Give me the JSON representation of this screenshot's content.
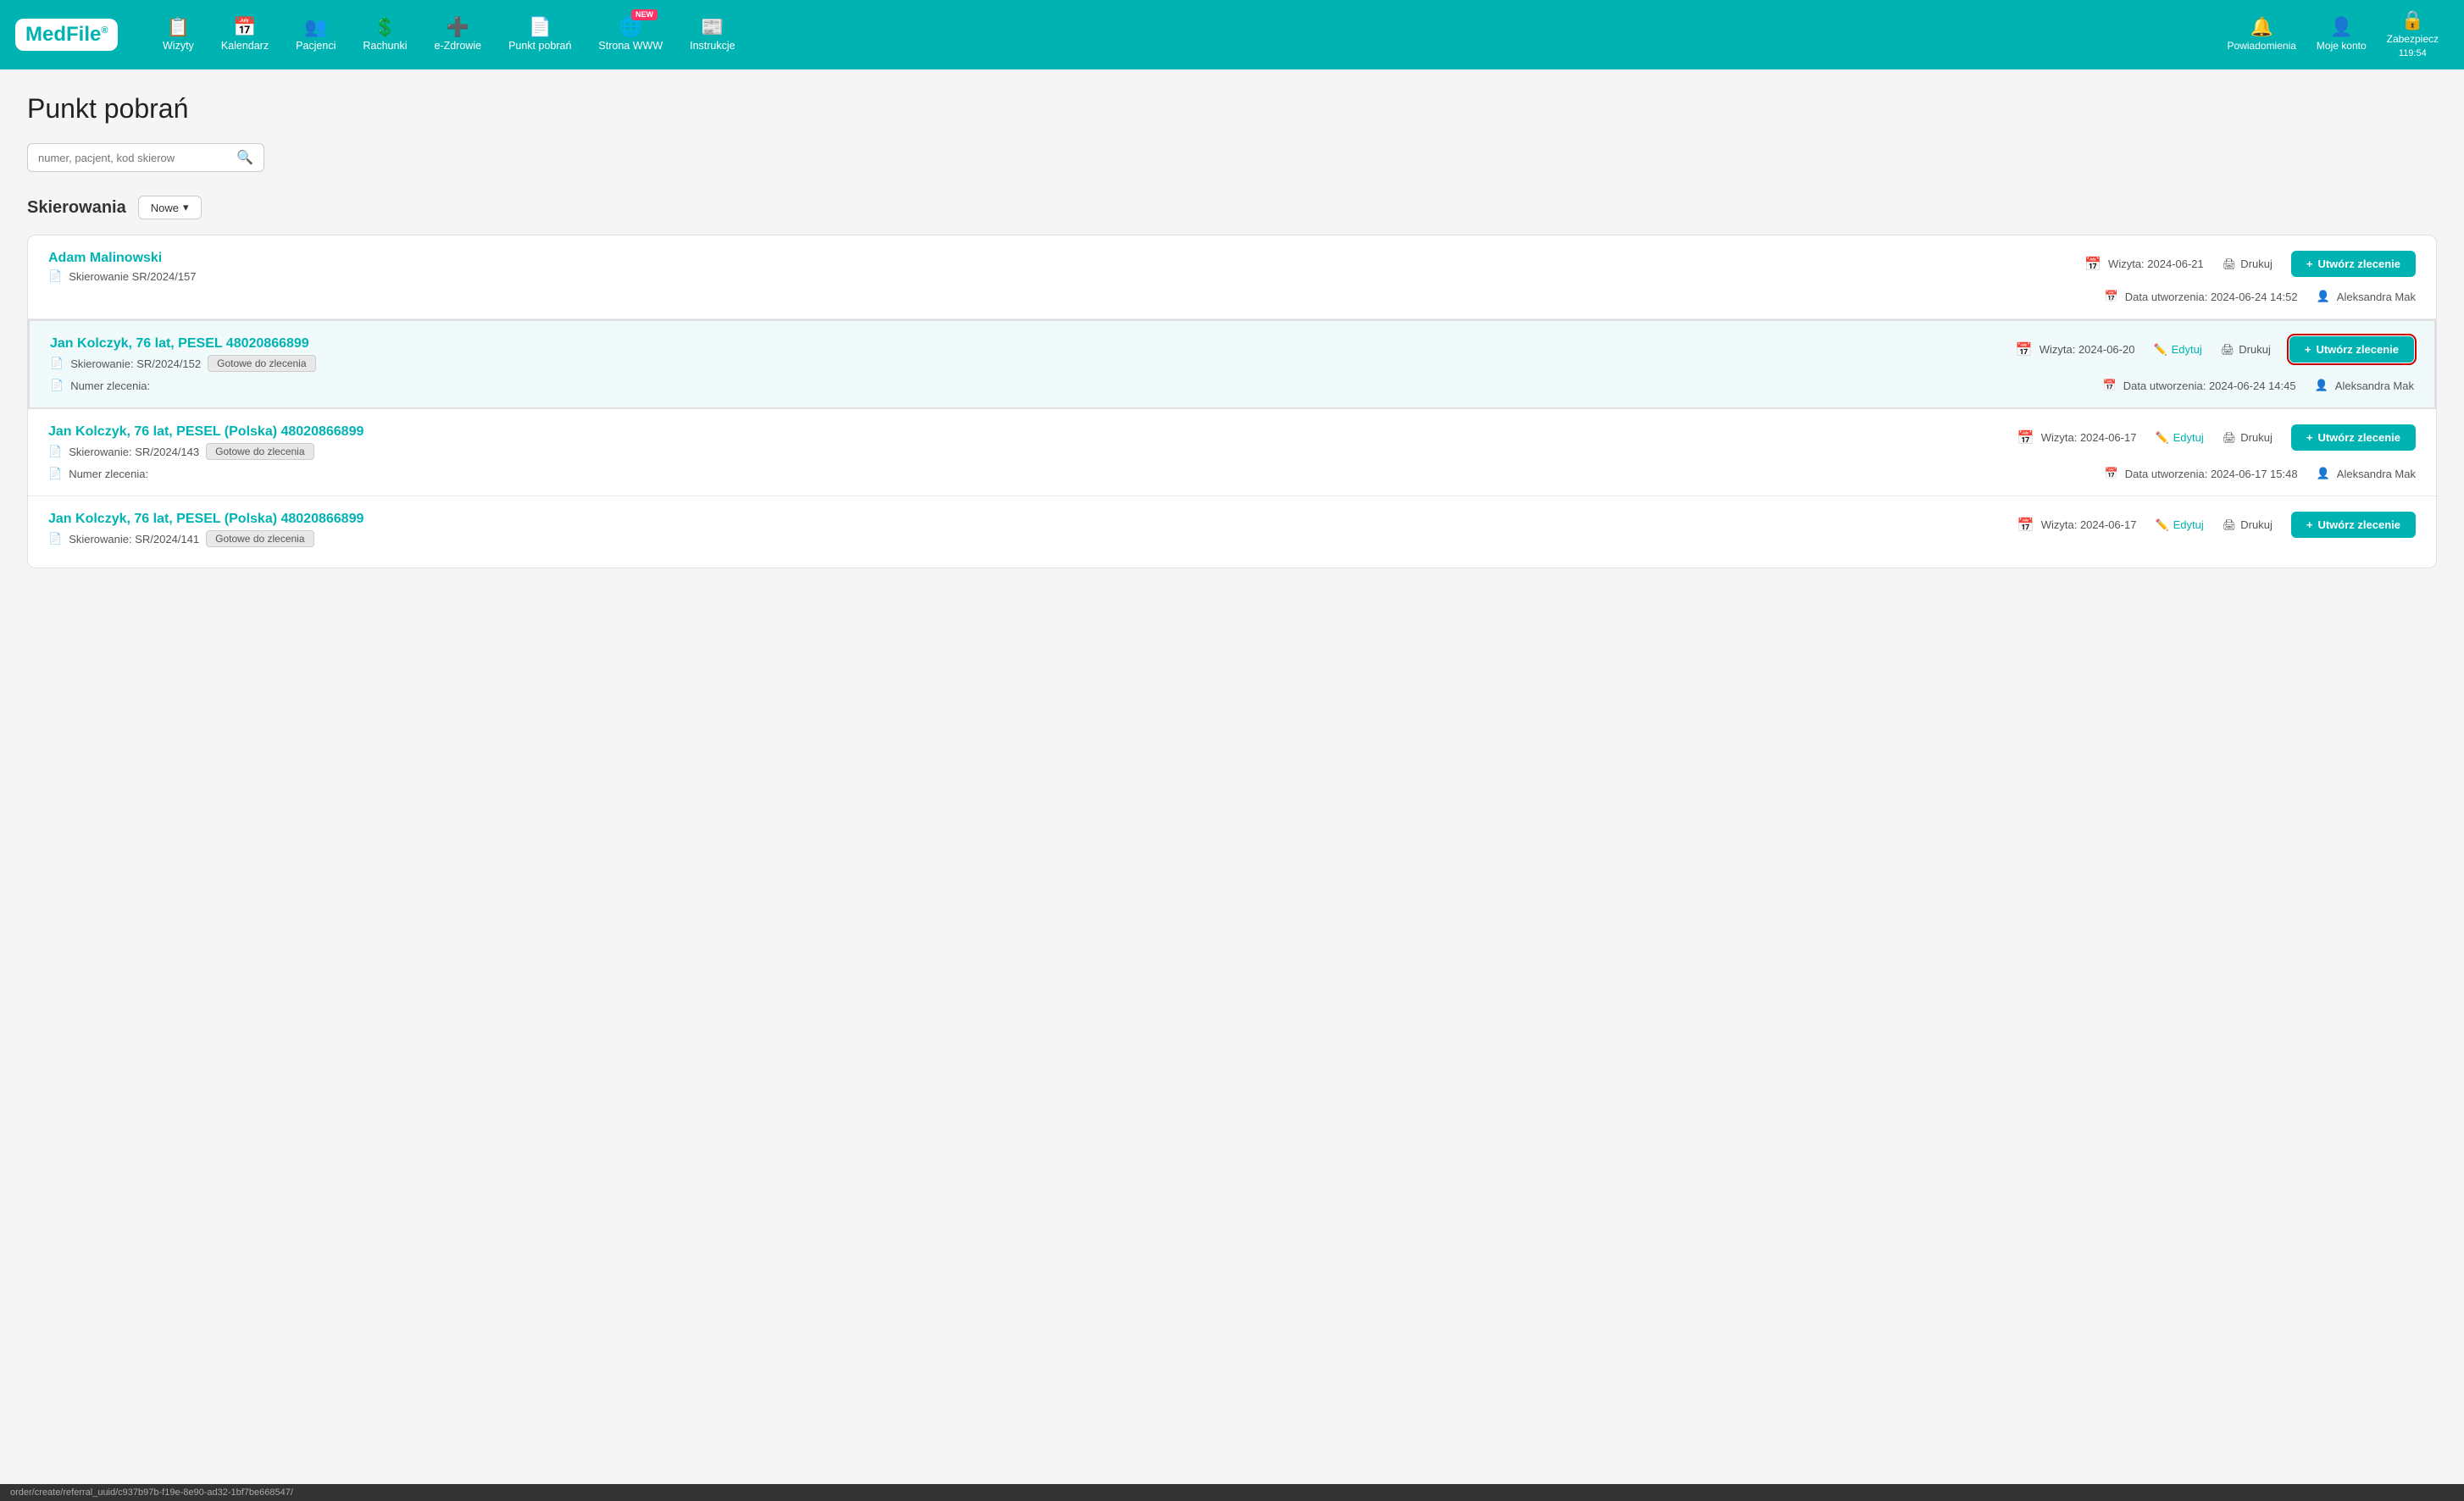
{
  "brand": {
    "med": "Med",
    "file": "File",
    "reg": "®"
  },
  "navbar": {
    "items": [
      {
        "id": "wizyty",
        "label": "Wizyty",
        "icon": "📋"
      },
      {
        "id": "kalendarz",
        "label": "Kalendarz",
        "icon": "📅"
      },
      {
        "id": "pacjenci",
        "label": "Pacjenci",
        "icon": "👥"
      },
      {
        "id": "rachunki",
        "label": "Rachunki",
        "icon": "💲"
      },
      {
        "id": "e-zdrowie",
        "label": "e-Zdrowie",
        "icon": "➕"
      },
      {
        "id": "punkt-pobran",
        "label": "Punkt pobrań",
        "icon": "📄"
      },
      {
        "id": "strona-www",
        "label": "Strona WWW",
        "icon": "🌐",
        "badge": "NEW"
      },
      {
        "id": "instrukcje",
        "label": "Instrukcje",
        "icon": "📰"
      }
    ],
    "right_items": [
      {
        "id": "powiadomienia",
        "label": "Powiadomienia",
        "icon": "🔔"
      },
      {
        "id": "moje-konto",
        "label": "Moje konto",
        "icon": "👤"
      },
      {
        "id": "zabezpiecz",
        "label": "Zabezpiecz",
        "icon": "🔒",
        "sub": "119:54"
      }
    ]
  },
  "page": {
    "title": "Punkt pobrań"
  },
  "search": {
    "placeholder": "numer, pacjent, kod skierow"
  },
  "section": {
    "title": "Skierowania",
    "filter_label": "Nowe",
    "filter_arrow": "▾"
  },
  "cards": [
    {
      "id": "card-1",
      "patient": "Adam Malinowski",
      "ref_label": "Skierowanie SR/2024/157",
      "status_badge": null,
      "visit_label": "Wizyta: 2024-06-21",
      "print_label": "Drukuj",
      "created_label": "Data utworzenia: 2024-06-24 14:52",
      "author": "Aleksandra Mak",
      "edit_label": null,
      "order_label": "Utwórz zlecenie",
      "numer_zlecenia": null,
      "highlighted": false
    },
    {
      "id": "card-2",
      "patient": "Jan Kolczyk, 76 lat, PESEL 48020866899",
      "ref_label": "Skierowanie: SR/2024/152",
      "status_badge": "Gotowe do zlecenia",
      "visit_label": "Wizyta: 2024-06-20",
      "print_label": "Drukuj",
      "created_label": "Data utworzenia: 2024-06-24 14:45",
      "author": "Aleksandra Mak",
      "edit_label": "Edytuj",
      "order_label": "Utwórz zlecenie",
      "numer_zlecenia": "Numer zlecenia:",
      "highlighted": true,
      "active_cursor": true
    },
    {
      "id": "card-3",
      "patient": "Jan Kolczyk, 76 lat, PESEL (Polska) 48020866899",
      "ref_label": "Skierowanie: SR/2024/143",
      "status_badge": "Gotowe do zlecenia",
      "visit_label": "Wizyta: 2024-06-17",
      "print_label": "Drukuj",
      "created_label": "Data utworzenia: 2024-06-17 15:48",
      "author": "Aleksandra Mak",
      "edit_label": "Edytuj",
      "order_label": "Utwórz zlecenie",
      "numer_zlecenia": "Numer zlecenia:",
      "highlighted": false
    },
    {
      "id": "card-4",
      "patient": "Jan Kolczyk, 76 lat, PESEL (Polska) 48020866899",
      "ref_label": "Skierowanie: SR/2024/141",
      "status_badge": "Gotowe do zlecenia",
      "visit_label": "Wizyta: 2024-06-17",
      "print_label": "Drukuj",
      "created_label": null,
      "author": null,
      "edit_label": "Edytuj",
      "order_label": "Utwórz zlecenie",
      "numer_zlecenia": null,
      "highlighted": false
    }
  ],
  "statusbar": {
    "url": "order/create/referral_uuid/c937b97b-f19e-8e90-ad32-1bf7be668547/"
  },
  "icons": {
    "search": "🔍",
    "calendar": "📅",
    "file": "📄",
    "printer": "🖨",
    "user": "👤",
    "edit": "✏️",
    "plus": "+"
  }
}
